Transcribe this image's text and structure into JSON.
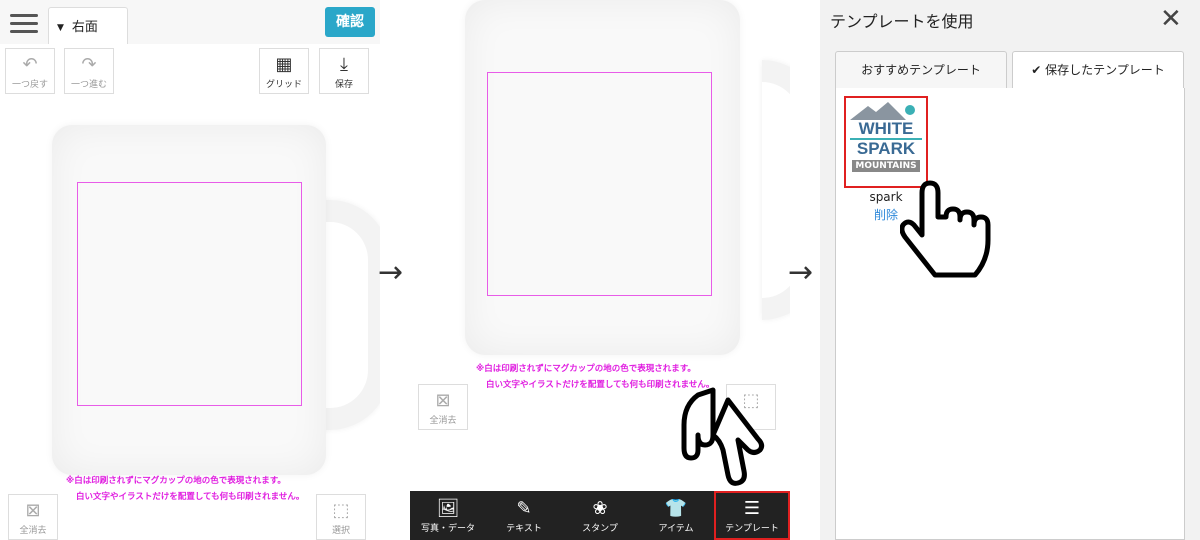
{
  "screen1": {
    "tab_label": "右面",
    "confirm_label": "確認",
    "undo_label": "一つ戻す",
    "redo_label": "一つ進む",
    "grid_label": "グリッド",
    "save_label": "保存",
    "clear_label": "全消去",
    "select_label": "選択",
    "warning_line1": "※白は印刷されずにマグカップの地の色で表現されます。",
    "warning_line2": "白い文字やイラストだけを配置しても何も印刷されません。"
  },
  "screen2": {
    "clear_label": "全消去",
    "warning_line1": "※白は印刷されずにマグカップの地の色で表現されます。",
    "warning_line2": "白い文字やイラストだけを配置しても何も印刷されません。",
    "bottom_nav": [
      {
        "label": "写真・データ",
        "icon": "image-icon"
      },
      {
        "label": "テキスト",
        "icon": "pencil-icon"
      },
      {
        "label": "スタンプ",
        "icon": "stamp-icon"
      },
      {
        "label": "アイテム",
        "icon": "shirt-icon"
      },
      {
        "label": "テンプレート",
        "icon": "list-icon"
      }
    ]
  },
  "screen3": {
    "title": "テンプレートを使用",
    "tab_recommended": "おすすめテンプレート",
    "tab_saved": "保存したテンプレート",
    "template": {
      "logo_line1": "WHITE",
      "logo_line2": "SPARK",
      "logo_line3": "MOUNTAINS",
      "name": "spark",
      "delete_label": "削除"
    }
  },
  "arrow_glyph": "→",
  "colors": {
    "accent": "#2aa7c9",
    "print_area": "#e85ce8",
    "warning_text": "#e01ee0",
    "highlight": "#e02020",
    "delete_link": "#2d88d9"
  }
}
